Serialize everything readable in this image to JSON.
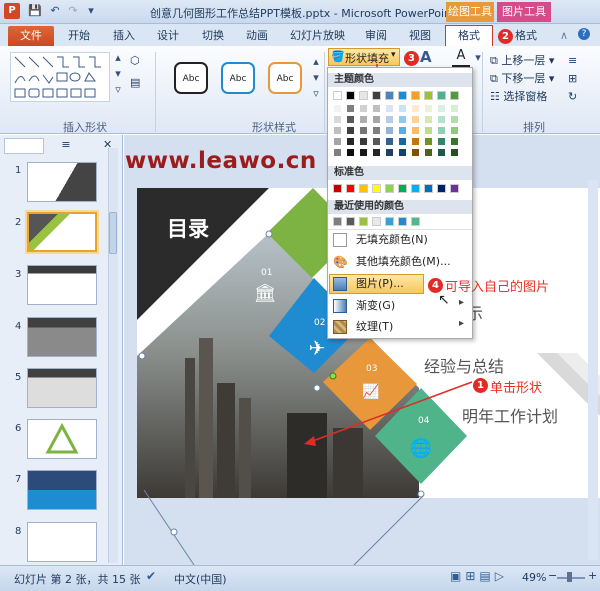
{
  "titlebar": {
    "title": "创意几何图形工作总结PPT模板.pptx - Microsoft PowerPoint",
    "ctx_drawing": "绘图工具",
    "ctx_picture": "图片工具",
    "logo": "P"
  },
  "tabs": {
    "file": "文件",
    "items": [
      "开始",
      "插入",
      "设计",
      "切换",
      "动画",
      "幻灯片放映",
      "审阅",
      "视图"
    ],
    "format_active": "格式",
    "format2": "格式"
  },
  "ribbon": {
    "group_insert_shape": "插入形状",
    "group_shape_style": "形状样式",
    "group_arrange": "排列",
    "style_samples": [
      "Abc",
      "Abc",
      "Abc"
    ],
    "shape_fill": "形状填充",
    "bring_forward": "上移一层",
    "send_backward": "下移一层",
    "selection_pane": "选择窗格"
  },
  "menu": {
    "theme_colors": "主题颜色",
    "standard_colors": "标准色",
    "recent_colors": "最近使用的颜色",
    "no_fill": "无填充颜色(N)",
    "more_colors": "其他填充颜色(M)...",
    "picture": "图片(P)...",
    "gradient": "渐变(G)",
    "texture": "纹理(T)",
    "theme_top_row": [
      "#ffffff",
      "#000000",
      "#e6e6e6",
      "#3f3f3f",
      "#4f81bd",
      "#1f8bd1",
      "#f0a12b",
      "#9ac241",
      "#4cb18c",
      "#4a9f3c"
    ],
    "theme_columns": [
      [
        "#f2f2f2",
        "#d9d9d9",
        "#bfbfbf",
        "#a5a5a5",
        "#7f7f7f"
      ],
      [
        "#7f7f7f",
        "#595959",
        "#3f3f3f",
        "#262626",
        "#0c0c0c"
      ],
      [
        "#d0d0d0",
        "#aeaeae",
        "#757575",
        "#3a3a3a",
        "#171717"
      ],
      [
        "#bfbfbf",
        "#a5a5a5",
        "#7f7f7f",
        "#595959",
        "#262626"
      ],
      [
        "#dbe5f1",
        "#b8cce4",
        "#95b3d7",
        "#366092",
        "#244061"
      ],
      [
        "#c6e4f6",
        "#8dcaee",
        "#55afe5",
        "#136aa0",
        "#0c466b"
      ],
      [
        "#fde9cc",
        "#fbd399",
        "#f9bd66",
        "#c27708",
        "#815005"
      ],
      [
        "#ebf2d8",
        "#d7e6b2",
        "#c3d98b",
        "#729125",
        "#4c6119"
      ],
      [
        "#dbefe6",
        "#b7dfce",
        "#93cfb5",
        "#358466",
        "#235844"
      ],
      [
        "#d8eed3",
        "#b1dda8",
        "#8acc7c",
        "#37772c",
        "#254f1e"
      ]
    ],
    "standard_row": [
      "#c00000",
      "#ff0000",
      "#ffc000",
      "#ffff00",
      "#92d050",
      "#00b050",
      "#00b0f0",
      "#0070c0",
      "#002060",
      "#7030a0"
    ],
    "recent_row": [
      "#7f7f7f",
      "#5a5a5a",
      "#9ac241",
      "#e8e8e8",
      "#3aa0d8",
      "#1f8bd1",
      "#55b68c"
    ]
  },
  "slides": {
    "numbers": [
      "1",
      "2",
      "3",
      "4",
      "5",
      "6",
      "7",
      "8"
    ]
  },
  "slide": {
    "title": "目录",
    "num1": "01",
    "num2": "02",
    "num3": "03",
    "num4": "04",
    "text_experience": "经验与总结",
    "text_plan": "明年工作计划",
    "text_partial": "示"
  },
  "watermark": "www.leawo.cn",
  "annotations": {
    "b1": "1",
    "t1": "单击形状",
    "b2": "2",
    "b3": "3",
    "b4": "4",
    "t4": "可导入自己的图片"
  },
  "status": {
    "slide_info": "幻灯片 第 2 张，共 15 张",
    "language": "中文(中国)",
    "zoom": "49%"
  },
  "colors": {
    "accent_red": "#e02b27",
    "green": "#7cb342",
    "blue": "#1f8bd1",
    "orange": "#e8983b",
    "teal": "#4fb48a",
    "dark": "#2b2b2b"
  }
}
